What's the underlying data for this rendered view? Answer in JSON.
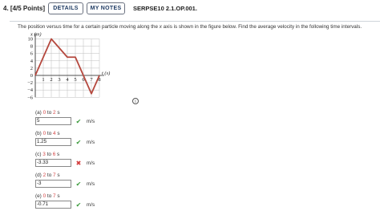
{
  "header": {
    "question_number": "4.",
    "points": "[4/5 Points]",
    "details_label": "DETAILS",
    "mynotes_label": "MY NOTES",
    "question_id": "SERPSE10 2.1.OP.001."
  },
  "prompt": {
    "before": "The position versus time for a certain particle moving along the ",
    "var": "x",
    "after": " axis is shown in the figure below. Find the average velocity in the following time intervals."
  },
  "graph": {
    "y_axis_label": "x (m)",
    "x_axis_label": "t (s)",
    "y_ticks": [
      "10",
      "8",
      "6",
      "4",
      "2",
      "0",
      "−2",
      "−4",
      "−6"
    ],
    "x_ticks": [
      "1",
      "2",
      "3",
      "4",
      "5",
      "6",
      "7",
      "8"
    ],
    "line_color": "#b5483e",
    "points_t": [
      0,
      2,
      4,
      5,
      6,
      7,
      8
    ],
    "points_x": [
      0,
      10,
      5,
      5,
      0,
      -5,
      0
    ]
  },
  "info_icon": "info-icon",
  "parts": [
    {
      "prefix": "(a) ",
      "t1": "0",
      "sep": " to ",
      "t2": "2",
      "suffix": " s",
      "value": "5",
      "status": "correct",
      "unit": "m/s"
    },
    {
      "prefix": "(b) ",
      "t1": "0",
      "sep": " to ",
      "t2": "4",
      "suffix": " s",
      "value": "1.25",
      "status": "correct",
      "unit": "m/s"
    },
    {
      "prefix": "(c) ",
      "t1": "3",
      "sep": " to ",
      "t2": "6",
      "suffix": " s",
      "value": "-3.33",
      "status": "incorrect",
      "unit": "m/s"
    },
    {
      "prefix": "(d) ",
      "t1": "2",
      "sep": " to ",
      "t2": "7",
      "suffix": " s",
      "value": "-3",
      "status": "correct",
      "unit": "m/s"
    },
    {
      "prefix": "(e) ",
      "t1": "0",
      "sep": " to ",
      "t2": "7",
      "suffix": " s",
      "value": "-0.71",
      "status": "correct",
      "unit": "m/s"
    }
  ]
}
